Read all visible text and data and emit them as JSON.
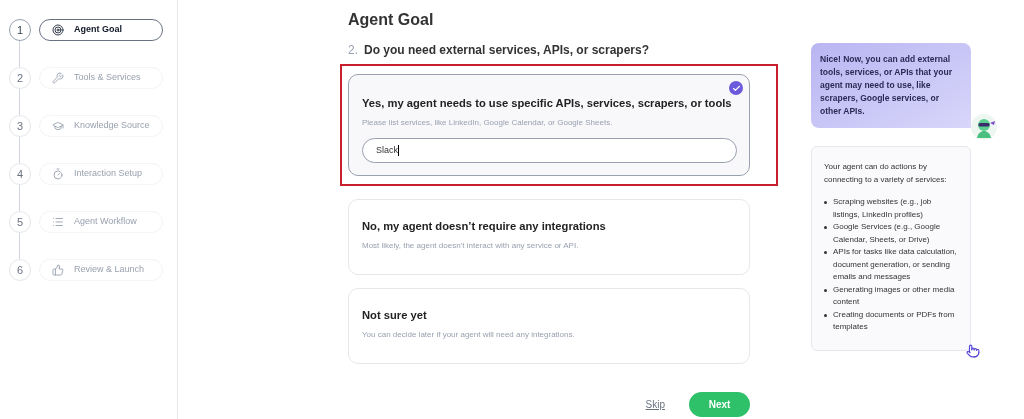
{
  "steps": [
    {
      "number": "1",
      "label": "Agent Goal",
      "selected": true
    },
    {
      "number": "2",
      "label": "Tools & Services",
      "selected": false
    },
    {
      "number": "3",
      "label": "Knowledge Source",
      "selected": false
    },
    {
      "number": "4",
      "label": "Interaction Setup",
      "selected": false
    },
    {
      "number": "5",
      "label": "Agent Workflow",
      "selected": false
    },
    {
      "number": "6",
      "label": "Review & Launch",
      "selected": false
    }
  ],
  "heading": "Agent Goal",
  "question": {
    "number": "2.",
    "text": "Do you need external services, APIs, or scrapers?"
  },
  "options": [
    {
      "title": "Yes, my agent needs to use specific APIs, services, scrapers, or tools",
      "description": "Please list services, like LinkedIn, Google Calendar, or Google Sheets.",
      "selected": true,
      "highlighted": true,
      "input_value": "Slack"
    },
    {
      "title": "No, my agent doesn’t require any integrations",
      "description": "Most likely, the agent doesn’t interact with any service or API.",
      "selected": false,
      "highlighted": false
    },
    {
      "title": "Not sure yet",
      "description": "You can decide later if your agent will need any integrations.",
      "selected": false,
      "highlighted": false
    }
  ],
  "actions": {
    "skip": "Skip",
    "next": "Next"
  },
  "assistant_bubble": "Nice! Now, you can add external tools, services, or APIs that your agent may need to use, like scrapers, Google services, or other APIs.",
  "info_card": {
    "intro": "Your agent can do actions by connecting to a variety of services:",
    "items": [
      "Scraping websites (e.g., job listings, LinkedIn profiles)",
      "Google Services (e.g., Google Calendar, Sheets, or Drive)",
      "APIs for tasks like data calculation, document generation, or sending emails and messages",
      "Generating images or other media content",
      "Creating documents or PDFs from templates"
    ]
  }
}
